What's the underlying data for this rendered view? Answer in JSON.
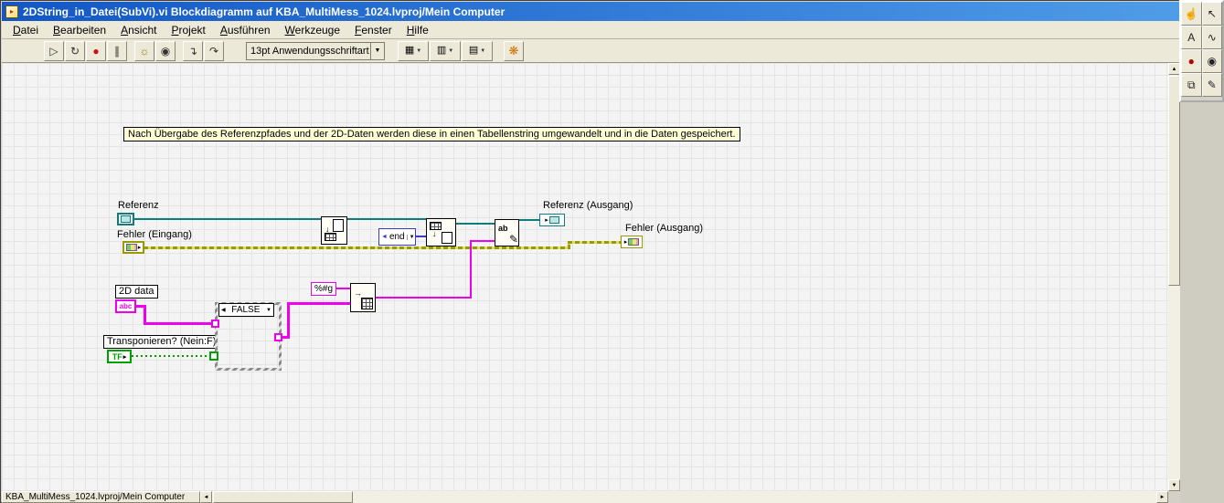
{
  "window": {
    "title": "2DString_in_Datei(SubVi).vi Blockdiagramm auf KBA_MultiMess_1024.lvproj/Mein Computer"
  },
  "menu": {
    "items": [
      {
        "label": "Datei"
      },
      {
        "label": "Bearbeiten"
      },
      {
        "label": "Ansicht"
      },
      {
        "label": "Projekt"
      },
      {
        "label": "Ausführen"
      },
      {
        "label": "Werkzeuge"
      },
      {
        "label": "Fenster"
      },
      {
        "label": "Hilfe"
      }
    ]
  },
  "toolbar": {
    "run_group": [
      {
        "name": "run-button",
        "glyph": "▷",
        "color": "#333333"
      },
      {
        "name": "run-continuous-button",
        "glyph": "↻",
        "color": "#333333"
      },
      {
        "name": "abort-button",
        "glyph": "●",
        "color": "#cc1111"
      },
      {
        "name": "pause-button",
        "glyph": "∥",
        "color": "#333333"
      }
    ],
    "debug_group": [
      {
        "name": "highlight-execution-button",
        "glyph": "☼",
        "color": "#8a6d00"
      },
      {
        "name": "retain-wire-values-button",
        "glyph": "◉",
        "color": "#333333"
      }
    ],
    "step_group": [
      {
        "name": "step-into-button",
        "glyph": "↴",
        "color": "#333333"
      },
      {
        "name": "step-over-button",
        "glyph": "↷",
        "color": "#333333"
      }
    ],
    "font_selector": {
      "value": "13pt Anwendungsschriftart"
    },
    "dropdown_group": [
      {
        "name": "align-objects-dropdown",
        "glyph": "▦"
      },
      {
        "name": "distribute-objects-dropdown",
        "glyph": "▥"
      },
      {
        "name": "reorder-dropdown",
        "glyph": "▤"
      }
    ],
    "cleanup_button": {
      "glyph": "❋"
    }
  },
  "palette": {
    "tools": [
      {
        "name": "operate-value-tool",
        "glyph": "☝",
        "color": "#222222"
      },
      {
        "name": "position-select-tool",
        "glyph": "↖",
        "color": "#222222"
      },
      {
        "name": "edit-text-tool",
        "glyph": "A",
        "color": "#222222"
      },
      {
        "name": "connect-wire-tool",
        "glyph": "∿",
        "color": "#222222"
      },
      {
        "name": "breakpoint-tool",
        "glyph": "●",
        "color": "#b00000"
      },
      {
        "name": "probe-tool",
        "glyph": "◉",
        "color": "#222222"
      },
      {
        "name": "get-color-tool",
        "glyph": "⧉",
        "color": "#222222"
      },
      {
        "name": "set-color-tool",
        "glyph": "✎",
        "color": "#222222"
      }
    ]
  },
  "diagram": {
    "comment": "Nach Übergabe des Referenzpfades und der 2D-Daten werden diese in einen Tabellenstring umgewandelt und in die Daten gespeichert.",
    "labels": {
      "referenz": "Referenz",
      "fehler_eingang": "Fehler (Eingang)",
      "data_2d": "2D data",
      "transponieren": "Transponieren? (Nein:F)",
      "referenz_ausgang": "Referenz (Ausgang)",
      "fehler_ausgang": "Fehler (Ausgang)"
    },
    "terminals": {
      "data_2d_glyph": "abc",
      "tf_glyph": "TF"
    },
    "constants": {
      "case_selector": "FALSE",
      "format_string": "%#g",
      "file_position": "end"
    },
    "nodes": {
      "write_text_glyph": "ab"
    }
  },
  "statusbar": {
    "tab_label": "KBA_MultiMess_1024.lvproj/Mein Computer"
  },
  "colors": {
    "titlebar_left": "#1257c5",
    "titlebar_right": "#4f9ce8",
    "wire_path": "#117c7c",
    "wire_error": "#9b9b00",
    "wire_string": "#ee00ee",
    "wire_bool": "#00a000",
    "wire_enum": "#3a3ad0",
    "comment_bg": "#ffffd6",
    "canvas_bg": "#f4f4f4",
    "chrome_bg": "#ece9d8",
    "frame_bg": "#d4d0c8"
  }
}
